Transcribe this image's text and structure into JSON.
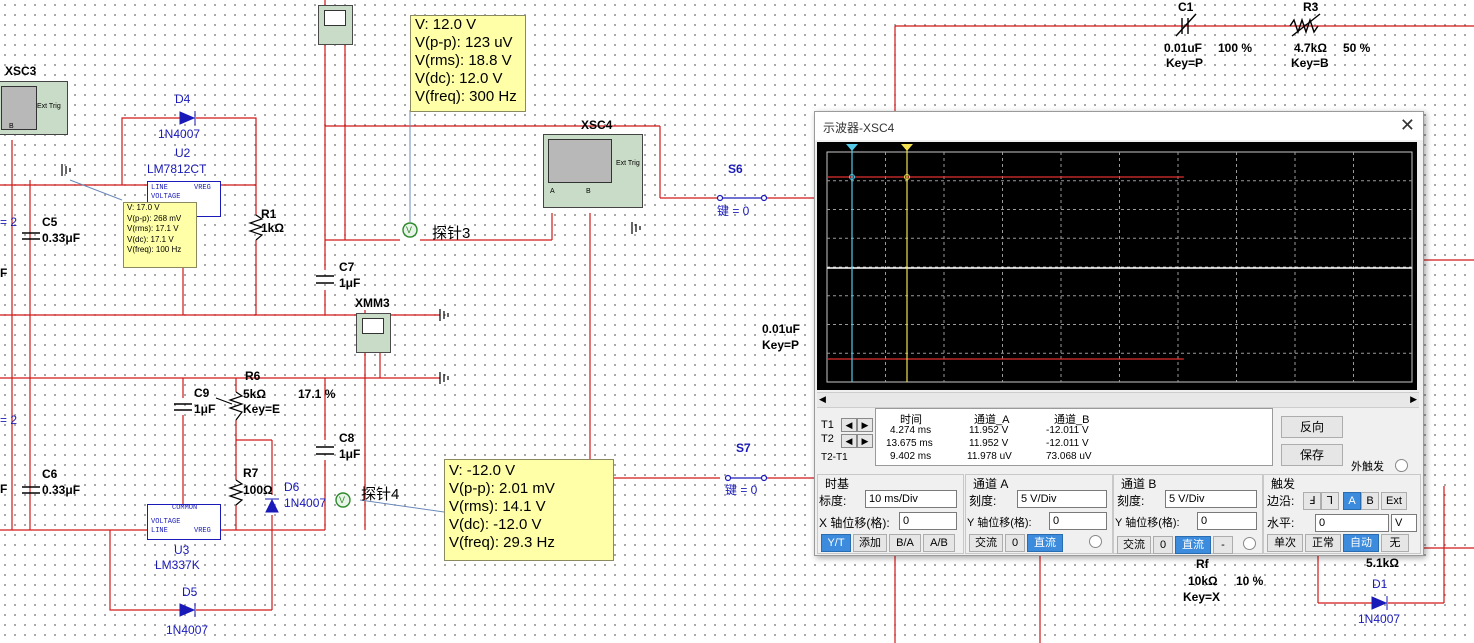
{
  "probes": {
    "probe3": {
      "lines": [
        "V: 12.0 V",
        "V(p-p): 123 uV",
        "V(rms): 18.8 V",
        "V(dc): 12.0 V",
        "V(freq): 300 Hz"
      ],
      "name": "探针3"
    },
    "probe4": {
      "lines": [
        "V: -12.0 V",
        "V(p-p): 2.01 mV",
        "V(rms): 14.1 V",
        "V(dc): -12.0 V",
        "V(freq): 29.3 Hz"
      ],
      "name": "探针4"
    },
    "probe_small": {
      "lines": [
        "V: 17.0 V",
        "V(p-p): 268 mV",
        "V(rms): 17.1 V",
        "V(dc): 17.1 V",
        "V(freq): 100 Hz"
      ]
    }
  },
  "schematic": {
    "xsc3": "XSC3",
    "xsc4": "XSC4",
    "xmm3": "XMM3",
    "scope_a": "A",
    "scope_b": "B",
    "ext_trig": "Ext Trig",
    "d4": {
      "ref": "D4",
      "model": "1N4007"
    },
    "u2": {
      "ref": "U2",
      "model": "LM7812CT",
      "line": "LINE",
      "vreg": "VREG",
      "voltage": "VOLTAGE"
    },
    "u3": {
      "ref": "U3",
      "model": "LM337K",
      "common": "COMMON",
      "voltage": "VOLTAGE",
      "line": "LINE",
      "vreg": "VREG"
    },
    "r1": {
      "ref": "R1",
      "value": "1kΩ"
    },
    "c5": {
      "ref": "C5",
      "value": "0.33μF"
    },
    "c6": {
      "ref": "C6",
      "value": "0.33μF"
    },
    "c7": {
      "ref": "C7",
      "value": "1μF"
    },
    "c8": {
      "ref": "C8",
      "value": "1μF"
    },
    "c9": {
      "ref": "C9",
      "value": "1μF"
    },
    "r6": {
      "ref": "R6",
      "value": "5kΩ",
      "key": "Key=E",
      "percent": "17.1 %"
    },
    "r7": {
      "ref": "R7",
      "value": "100Ω"
    },
    "d6": {
      "ref": "D6",
      "model": "1N4007"
    },
    "d5": {
      "ref": "D5",
      "model": "1N4007"
    },
    "d1": {
      "ref": "D1",
      "model": "1N4007"
    },
    "c1": {
      "ref": "C1",
      "value": "0.01uF",
      "percent": "100 %",
      "key": "Key=P"
    },
    "r3": {
      "ref": "R3",
      "value": "4.7kΩ",
      "percent": "50 %",
      "key": "Key=B"
    },
    "s6": {
      "ref": "S6",
      "key": "键 = 0"
    },
    "s7": {
      "ref": "S7",
      "key": "键 = 0"
    },
    "c_mid": {
      "value": "0.01uF",
      "key": "Key=P"
    },
    "rf": {
      "ref": "Rf",
      "value": "10kΩ",
      "percent": "10 %",
      "key": "Key=X"
    },
    "r_51k": "5.1kΩ",
    "frag_eq2a": "= 2",
    "frag_eq2b": "= 2",
    "frag_f1": "F",
    "frag_f2": "F",
    "frag_f3": "F"
  },
  "oscilloscope": {
    "title": "示波器-XSC4",
    "close": "✕",
    "cursor_rows": [
      "T1",
      "T2",
      "T2-T1"
    ],
    "arrow_left": "◀",
    "arrow_right": "▶",
    "measurements": {
      "headers": [
        "时间",
        "通道_A",
        "通道_B"
      ],
      "rows": [
        [
          "4.274 ms",
          "11.952 V",
          "-12.011 V"
        ],
        [
          "13.675 ms",
          "11.952 V",
          "-12.011 V"
        ],
        [
          "9.402 ms",
          "11.978 uV",
          "73.068 uV"
        ]
      ]
    },
    "reverse_button": "反向",
    "save_button": "保存",
    "ext_trigger_label": "外触发",
    "timebase": {
      "title": "时基",
      "scale_label": "标度:",
      "scale_value": "10 ms/Div",
      "xpos_label": "X 轴位移(格):",
      "xpos_value": "0",
      "modes": [
        "Y/T",
        "添加",
        "B/A",
        "A/B"
      ],
      "active_mode": "Y/T"
    },
    "channel_a": {
      "title": "通道 A",
      "scale_label": "刻度:",
      "scale_value": "5  V/Div",
      "ypos_label": "Y 轴位移(格):",
      "ypos_value": "0",
      "coupling": [
        "交流",
        "0",
        "直流"
      ],
      "active": "直流"
    },
    "channel_b": {
      "title": "通道 B",
      "scale_label": "刻度:",
      "scale_value": "5  V/Div",
      "ypos_label": "Y 轴位移(格):",
      "ypos_value": "0",
      "coupling": [
        "交流",
        "0",
        "直流",
        "-"
      ],
      "active": "直流"
    },
    "trigger": {
      "title": "触发",
      "edge_label": "边沿:",
      "edge_buttons": [
        "Ⅎ",
        "Ꞁ",
        "A",
        "B",
        "Ext"
      ],
      "active_source": "A",
      "level_label": "水平:",
      "level_value": "0",
      "level_unit": "V",
      "modes": [
        "单次",
        "正常",
        "自动",
        "无"
      ],
      "active_mode": "自动"
    },
    "trace_colors": {
      "a": "#e03030",
      "b": "#ffffff",
      "cursor1": "#55c8e8",
      "cursor2": "#f0e050",
      "grid": "#9a9a9a"
    }
  }
}
